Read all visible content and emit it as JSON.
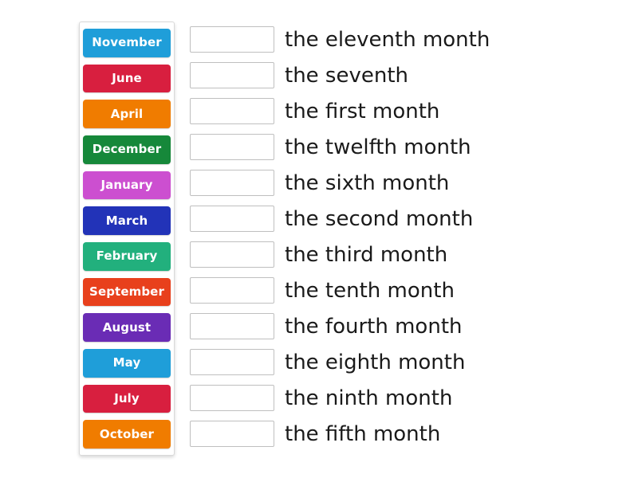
{
  "activity": {
    "type": "match-up",
    "tile_text_color": "#ffffff",
    "card_border_color": "#d9d9d9",
    "blank_border_color": "#bfbfbf",
    "definition_text_color": "#1a1a1a"
  },
  "tiles": [
    {
      "label": "November",
      "color": "#1f9ed9"
    },
    {
      "label": "June",
      "color": "#d81f3f"
    },
    {
      "label": "April",
      "color": "#f07c00"
    },
    {
      "label": "December",
      "color": "#16883a"
    },
    {
      "label": "January",
      "color": "#cc4fd0"
    },
    {
      "label": "March",
      "color": "#2233b8"
    },
    {
      "label": "February",
      "color": "#22b07d"
    },
    {
      "label": "September",
      "color": "#e8401c"
    },
    {
      "label": "August",
      "color": "#6a2cb5"
    },
    {
      "label": "May",
      "color": "#1f9ed9"
    },
    {
      "label": "July",
      "color": "#d81f3f"
    },
    {
      "label": "October",
      "color": "#f07c00"
    }
  ],
  "answers": [
    {
      "value": "",
      "definition": "the eleventh month"
    },
    {
      "value": "",
      "definition": "the seventh"
    },
    {
      "value": "",
      "definition": "the first month"
    },
    {
      "value": "",
      "definition": "the twelfth month"
    },
    {
      "value": "",
      "definition": "the sixth month"
    },
    {
      "value": "",
      "definition": "the second month"
    },
    {
      "value": "",
      "definition": "the third month"
    },
    {
      "value": "",
      "definition": "the tenth month"
    },
    {
      "value": "",
      "definition": "the fourth month"
    },
    {
      "value": "",
      "definition": "the eighth month"
    },
    {
      "value": "",
      "definition": "the ninth month"
    },
    {
      "value": "",
      "definition": "the fifth month"
    }
  ]
}
